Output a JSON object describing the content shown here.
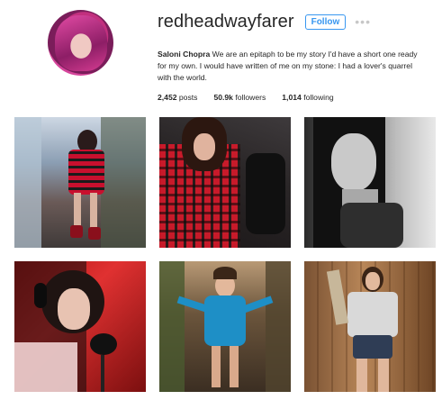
{
  "profile": {
    "username": "redheadwayfarer",
    "follow_label": "Follow",
    "more_label": "•••",
    "full_name": "Saloni Chopra",
    "bio": "We are an epitaph to be my story I'd have a short one ready for my own. I would have written of me on my stone: I had a lover's quarrel with the world."
  },
  "stats": {
    "posts_count": "2,452",
    "posts_label": "posts",
    "followers_count": "50.9k",
    "followers_label": "followers",
    "following_count": "1,014",
    "following_label": "following"
  },
  "colors": {
    "accent": "#3897f0",
    "text": "#262626"
  },
  "posts": [
    {
      "subject": "red plaid shirt dress in alley"
    },
    {
      "subject": "red plaid shirt close-up"
    },
    {
      "subject": "black and white portrait"
    },
    {
      "subject": "recording studio microphone"
    },
    {
      "subject": "blue lace-up romper"
    },
    {
      "subject": "grey tee and denim shorts"
    }
  ]
}
